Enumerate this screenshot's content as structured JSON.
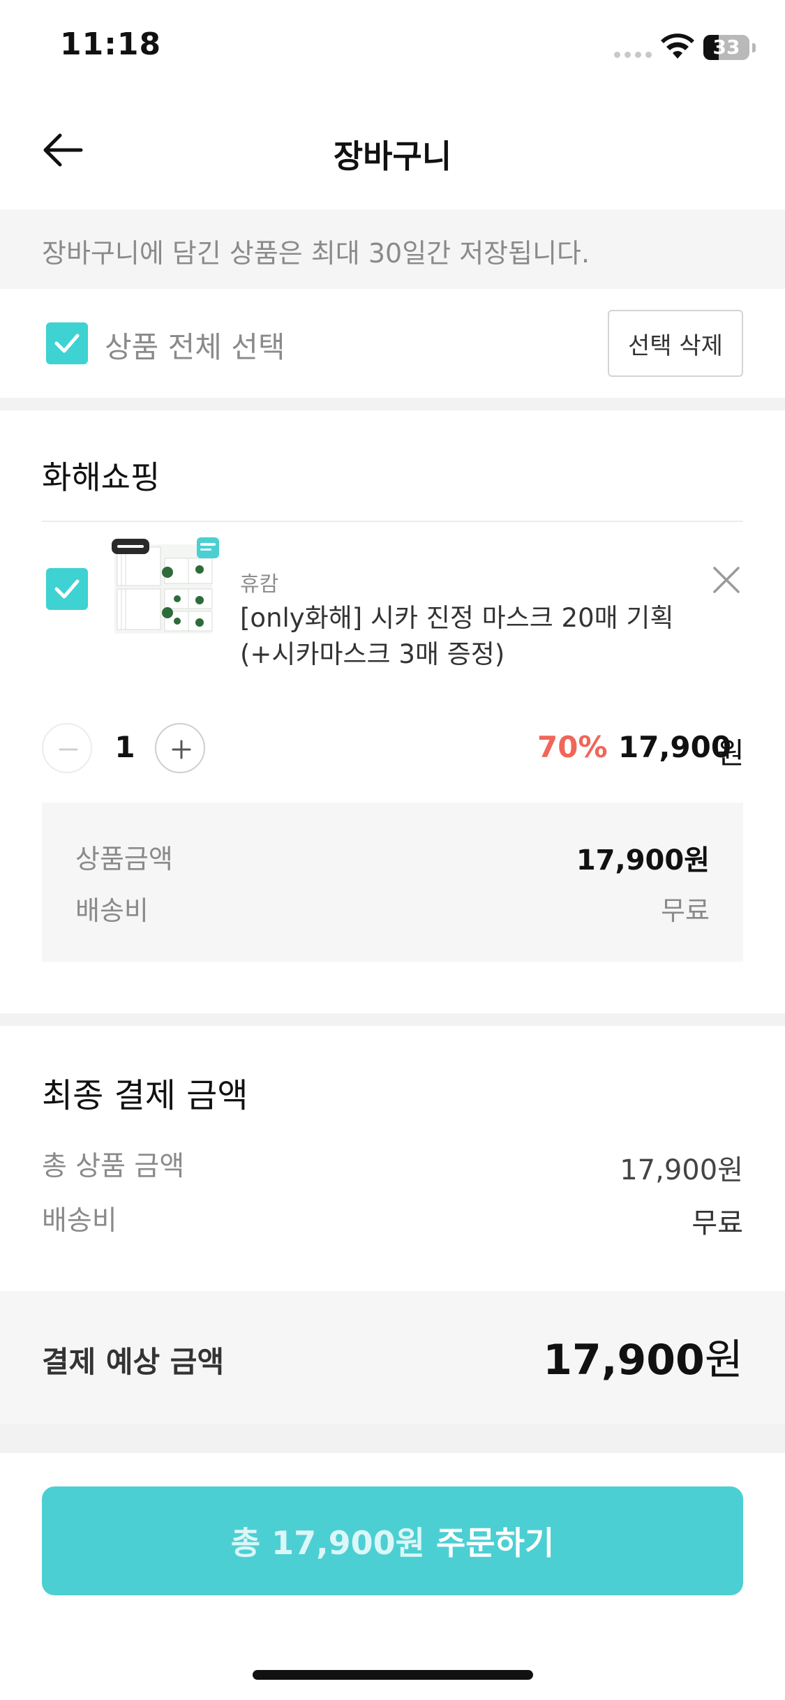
{
  "status_bar": {
    "time": "11:18",
    "battery": "33"
  },
  "header": {
    "title": "장바구니",
    "back_icon": "arrow-left-icon"
  },
  "notice": {
    "text": "장바구니에 담긴 상품은 최대 30일간 저장됩니다."
  },
  "selection": {
    "select_all_label": "상품 전체 선택",
    "select_all_checked": true,
    "delete_label": "선택 삭제"
  },
  "store": {
    "name": "화해쇼핑",
    "item": {
      "checked": true,
      "brand": "휴캄",
      "name": "[only화해] 시카 진정 마스크 20매 기획 (+시카마스크 3매 증정)",
      "quantity": "1",
      "discount": "70%",
      "price": "17,900",
      "currency": "원",
      "remove_icon": "close-icon"
    },
    "summary": {
      "product_amount_label": "상품금액",
      "product_amount_value": "17,900원",
      "shipping_label": "배송비",
      "shipping_value": "무료"
    }
  },
  "final": {
    "title": "최종 결제 금액",
    "total_label": "총 상품 금액",
    "total_value": "17,900원",
    "shipping_label": "배송비",
    "shipping_value": "무료",
    "expected_label": "결제 예상 금액",
    "expected_value": "17,900",
    "expected_unit": "원"
  },
  "order_button": {
    "amount": "총 17,900원",
    "action": "주문하기"
  },
  "colors": {
    "accent": "#4ccfd3",
    "checkbox": "#3fd2d2",
    "discount": "#f0665a"
  }
}
